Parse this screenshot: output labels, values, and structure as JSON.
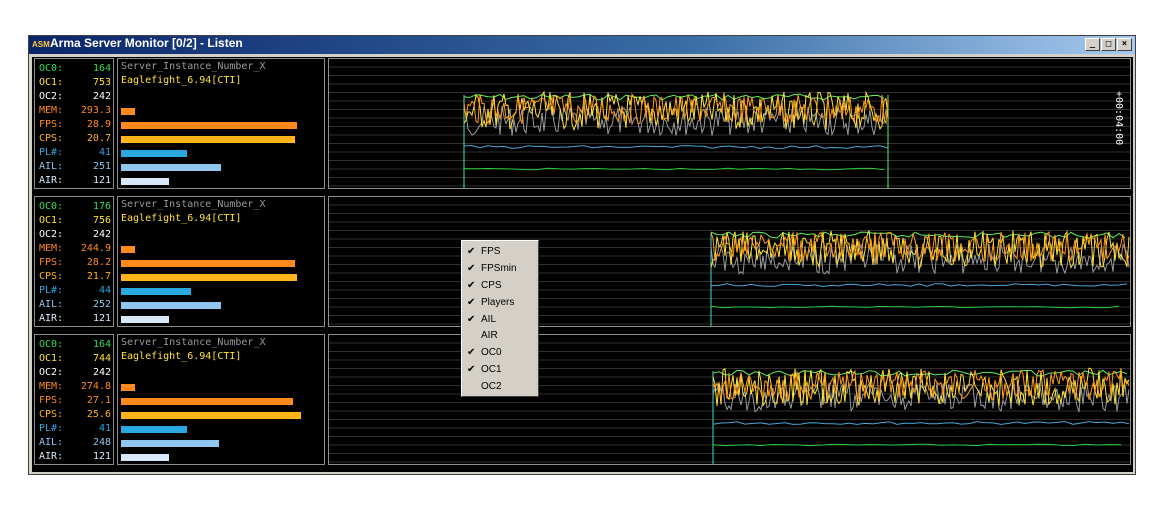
{
  "window": {
    "icon_text": "ASM",
    "title": "Arma Server Monitor [0/2] - Listen",
    "buttons": {
      "minimize": "_",
      "maximize": "□",
      "close": "×"
    }
  },
  "colors": {
    "oc0": "#33dd55",
    "oc1": "#ffe23a",
    "oc2": "#ffffff",
    "mem": "#ff8a1a",
    "fps": "#ff8a1a",
    "cps": "#ffb41a",
    "pl": "#2aa8e0",
    "ail": "#8ec6ee",
    "air": "#d8e8f8",
    "fps_line": "#ff9a1a",
    "fpsmin_line": "#ffe23a",
    "cps_line": "#9a9a9a",
    "players_line": "#4aa8d8",
    "oc_line": "#5ef05e",
    "oc1_line": "#2ecc40",
    "start_line": "#40e0d0"
  },
  "panels": [
    {
      "stats": [
        {
          "label": "OC0:",
          "value": "164",
          "key": "oc0"
        },
        {
          "label": "OC1:",
          "value": "753",
          "key": "oc1"
        },
        {
          "label": "OC2:",
          "value": "242",
          "key": "oc2"
        },
        {
          "label": "MEM:",
          "value": "293.3",
          "key": "mem"
        },
        {
          "label": "FPS:",
          "value": "28.9",
          "key": "fps"
        },
        {
          "label": "CPS:",
          "value": "20.7",
          "key": "cps"
        },
        {
          "label": "PL#:",
          "value": "41",
          "key": "pl"
        },
        {
          "label": "AIL:",
          "value": "251",
          "key": "ail"
        },
        {
          "label": "AIR:",
          "value": "121",
          "key": "air"
        }
      ],
      "server_name": "Server_Instance_Number_X",
      "mission": "Eaglefight_6.94[CTI]",
      "bar_levels": {
        "mem": 0.07,
        "fps": 0.88,
        "cps": 0.87,
        "pl": 0.33,
        "ail": 0.5,
        "air": 0.24
      },
      "graph": {
        "start": 0.168,
        "end": 0.698,
        "time_label": "+00:04:00"
      }
    },
    {
      "stats": [
        {
          "label": "OC0:",
          "value": "176",
          "key": "oc0"
        },
        {
          "label": "OC1:",
          "value": "756",
          "key": "oc1"
        },
        {
          "label": "OC2:",
          "value": "242",
          "key": "oc2"
        },
        {
          "label": "MEM:",
          "value": "244.9",
          "key": "mem"
        },
        {
          "label": "FPS:",
          "value": "28.2",
          "key": "fps"
        },
        {
          "label": "CPS:",
          "value": "21.7",
          "key": "cps"
        },
        {
          "label": "PL#:",
          "value": "44",
          "key": "pl"
        },
        {
          "label": "AIL:",
          "value": "252",
          "key": "ail"
        },
        {
          "label": "AIR:",
          "value": "121",
          "key": "air"
        }
      ],
      "server_name": "Server_Instance_Number_X",
      "mission": "Eaglefight_6.94[CTI]",
      "bar_levels": {
        "mem": 0.07,
        "fps": 0.87,
        "cps": 0.88,
        "pl": 0.35,
        "ail": 0.5,
        "air": 0.24
      },
      "graph": {
        "start": 0.477,
        "end": 1.0,
        "time_label": ""
      }
    },
    {
      "stats": [
        {
          "label": "OC0:",
          "value": "164",
          "key": "oc0"
        },
        {
          "label": "OC1:",
          "value": "744",
          "key": "oc1"
        },
        {
          "label": "OC2:",
          "value": "242",
          "key": "oc2"
        },
        {
          "label": "MEM:",
          "value": "274.8",
          "key": "mem"
        },
        {
          "label": "FPS:",
          "value": "27.1",
          "key": "fps"
        },
        {
          "label": "CPS:",
          "value": "25.6",
          "key": "cps"
        },
        {
          "label": "PL#:",
          "value": "41",
          "key": "pl"
        },
        {
          "label": "AIL:",
          "value": "248",
          "key": "ail"
        },
        {
          "label": "AIR:",
          "value": "121",
          "key": "air"
        }
      ],
      "server_name": "Server_Instance_Number_X",
      "mission": "Eaglefight_6.94[CTI]",
      "bar_levels": {
        "mem": 0.07,
        "fps": 0.86,
        "cps": 0.9,
        "pl": 0.33,
        "ail": 0.49,
        "air": 0.24
      },
      "graph": {
        "start": 0.48,
        "end": 1.0,
        "time_label": ""
      }
    }
  ],
  "context_menu": {
    "items": [
      {
        "label": "FPS",
        "checked": true
      },
      {
        "label": "FPSmin",
        "checked": true
      },
      {
        "label": "CPS",
        "checked": true
      },
      {
        "label": "Players",
        "checked": true
      },
      {
        "label": "AIL",
        "checked": true
      },
      {
        "label": "AIR",
        "checked": false
      },
      {
        "label": "OC0",
        "checked": true
      },
      {
        "label": "OC1",
        "checked": true
      },
      {
        "label": "OC2",
        "checked": false
      }
    ]
  }
}
